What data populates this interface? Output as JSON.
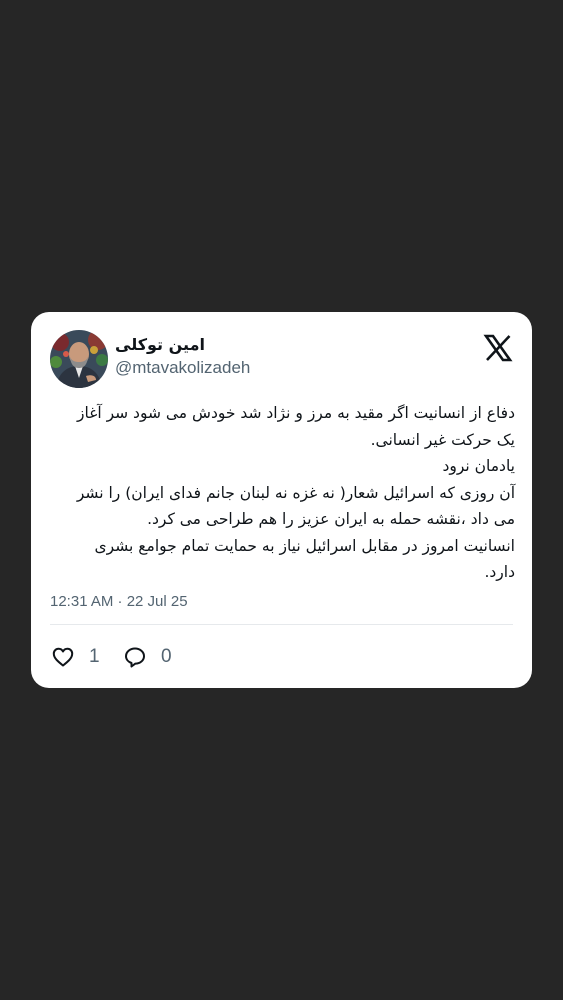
{
  "tweet": {
    "author": {
      "display_name": "امین توکلی",
      "handle": "@mtavakolizadeh"
    },
    "lines": [
      "دفاع از انسانیت اگر مقید به مرز و نژاد شد خودش می شود سر آغاز",
      "یک حرکت غیر انسانی.",
      "یادمان نرود",
      "آن روزی که اسرائیل شعار( نه غزه نه لبنان جانم فدای ایران) را نشر",
      "می داد ،نقشه حمله به ایران عزیز را هم طراحی می کرد.",
      "انسانیت امروز در مقابل اسرائیل نیاز به حمایت تمام جوامع بشری",
      "دارد."
    ],
    "timestamp": "12:31 AM · 22 Jul 25",
    "likes": "1",
    "replies": "0"
  },
  "icons": {
    "brand": "x-logo-icon",
    "like": "heart-icon",
    "reply": "speech-bubble-icon"
  },
  "colors": {
    "background": "#262626",
    "card": "#ffffff",
    "text_primary": "#0f1419",
    "text_secondary": "#536471"
  }
}
